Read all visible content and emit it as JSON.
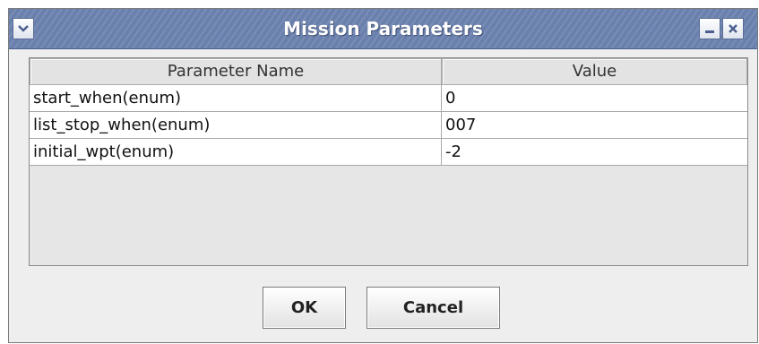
{
  "window": {
    "title": "Mission Parameters",
    "icons": [
      "chevron-down-icon",
      "minimize-icon",
      "close-icon"
    ]
  },
  "table": {
    "columns": [
      "Parameter Name",
      "Value"
    ],
    "rows": [
      {
        "name": "start_when(enum)",
        "value": "0"
      },
      {
        "name": "list_stop_when(enum)",
        "value": "007"
      },
      {
        "name": "initial_wpt(enum)",
        "value": "-2"
      }
    ]
  },
  "buttons": {
    "ok": "OK",
    "cancel": "Cancel"
  },
  "colors": {
    "titlebar": "#6a80ad",
    "window_bg": "#eeeeee",
    "table_bg": "#e6e6e6"
  }
}
